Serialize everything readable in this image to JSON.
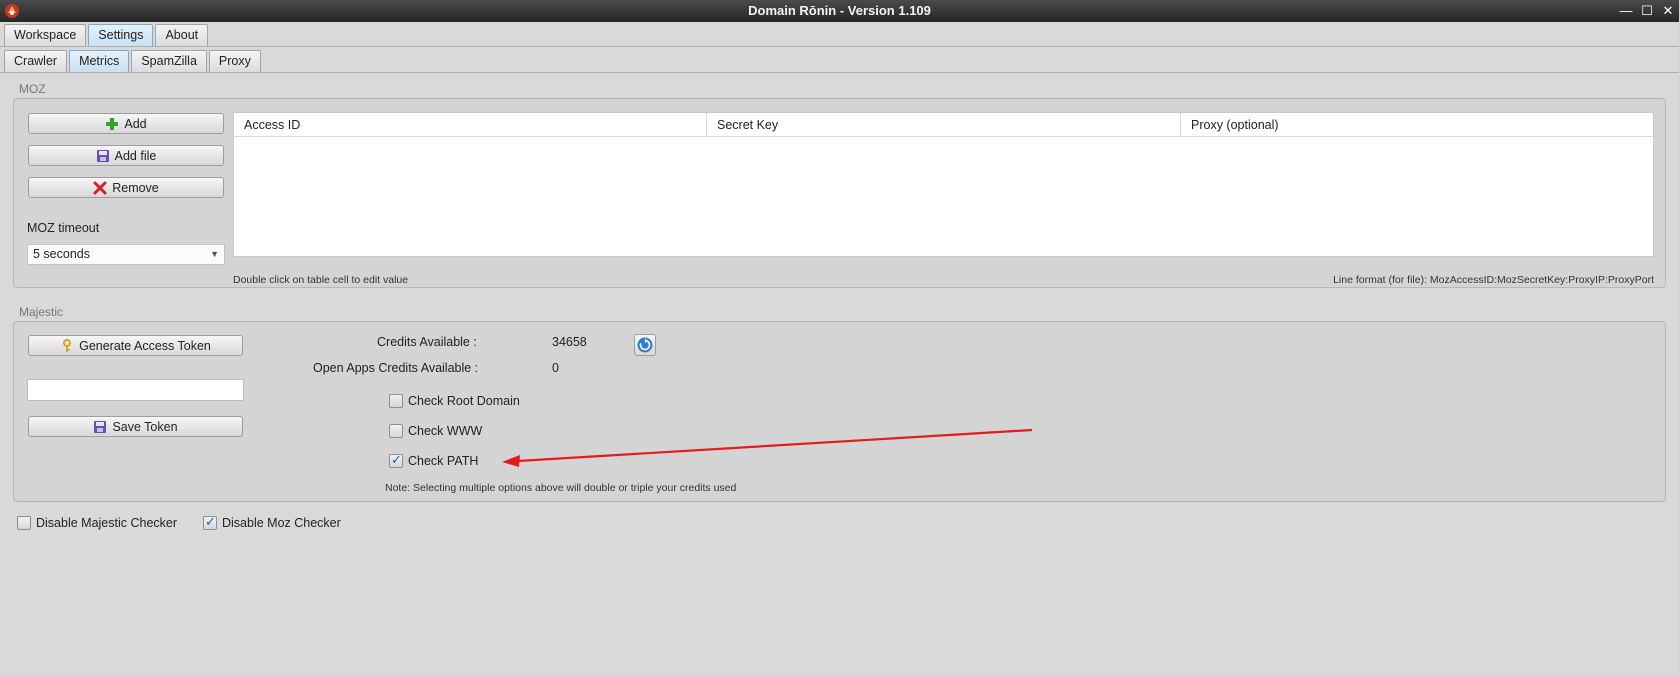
{
  "window": {
    "title": "Domain Rōnin - Version 1.109",
    "minimize": "—",
    "maximize": "☐",
    "close": "✕"
  },
  "main_tabs": [
    {
      "label": "Workspace",
      "active": false
    },
    {
      "label": "Settings",
      "active": true
    },
    {
      "label": "About",
      "active": false
    }
  ],
  "sub_tabs": [
    {
      "label": "Crawler",
      "active": false
    },
    {
      "label": "Metrics",
      "active": true
    },
    {
      "label": "SpamZilla",
      "active": false
    },
    {
      "label": "Proxy",
      "active": false
    }
  ],
  "moz": {
    "section_label": "MOZ",
    "add_label": "Add",
    "add_file_label": "Add file",
    "remove_label": "Remove",
    "timeout_label": "MOZ timeout",
    "timeout_value": "5 seconds",
    "table": {
      "columns": [
        "Access ID",
        "Secret Key",
        "Proxy (optional)"
      ],
      "rows": []
    },
    "hint_edit": "Double click on table cell to edit value",
    "hint_format": "Line format (for file): MozAccessID:MozSecretKey:ProxyIP:ProxyPort"
  },
  "majestic": {
    "section_label": "Majestic",
    "generate_token_label": "Generate Access Token",
    "token_value": "",
    "save_token_label": "Save Token",
    "credits_label": "Credits Available :",
    "credits_value": "34658",
    "open_apps_label": "Open Apps Credits Available :",
    "open_apps_value": "0",
    "check_root_label": "Check Root Domain",
    "check_root_checked": false,
    "check_www_label": "Check WWW",
    "check_www_checked": false,
    "check_path_label": "Check PATH",
    "check_path_checked": true,
    "note": "Note: Selecting multiple options above will double or triple your credits used"
  },
  "footer": {
    "disable_majestic_label": "Disable Majestic Checker",
    "disable_majestic_checked": false,
    "disable_moz_label": "Disable Moz Checker",
    "disable_moz_checked": true
  },
  "colors": {
    "annotation_arrow": "#e31b1b",
    "active_tab": "#c9e1f3",
    "add_icon": "#2ea52e",
    "remove_icon": "#d42020",
    "save_icon": "#6a4fb3",
    "key_icon": "#d9a520",
    "refresh_icon": "#2f7fd1"
  }
}
